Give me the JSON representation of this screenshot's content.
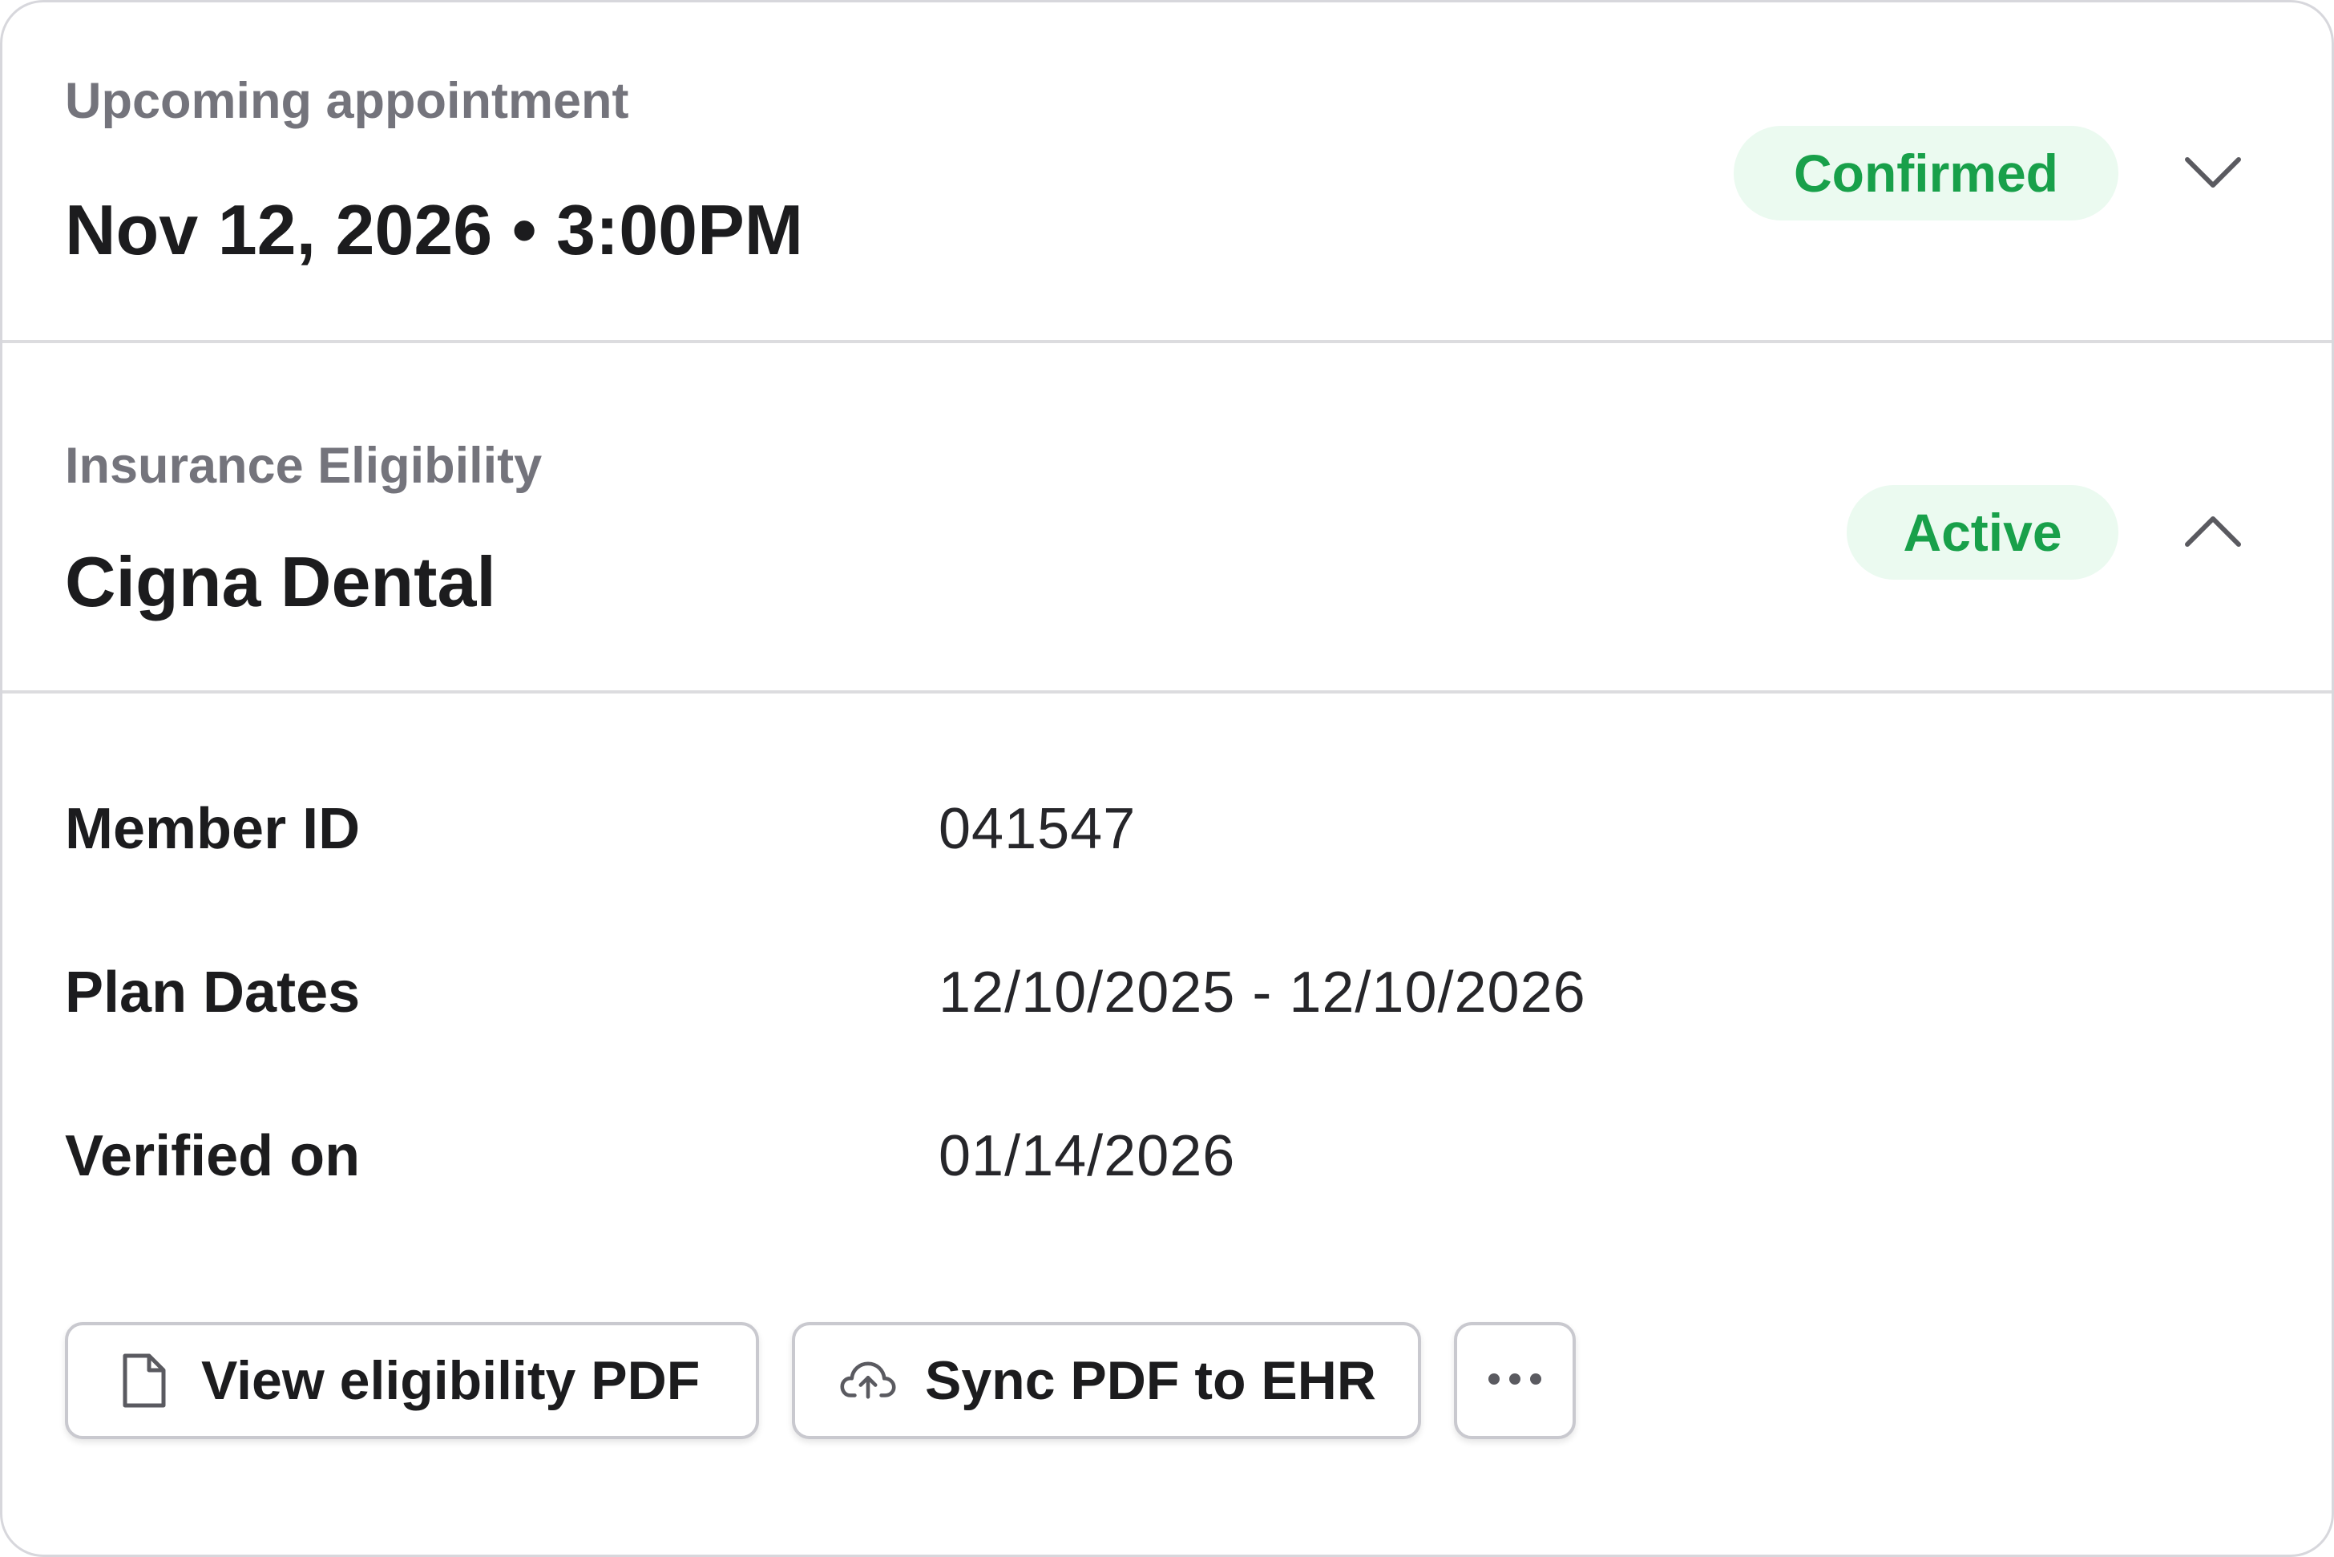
{
  "appointment": {
    "overline": "Upcoming appointment",
    "datetime": "Nov 12, 2026 • 3:00PM",
    "status": "Confirmed",
    "toggle_icon": "chevron-down-icon"
  },
  "insurance": {
    "overline": "Insurance Eligibility",
    "carrier": "Cigna Dental",
    "status": "Active",
    "toggle_icon": "chevron-up-icon",
    "details": [
      {
        "label": "Member ID",
        "value": "041547"
      },
      {
        "label": "Plan Dates",
        "value": "12/10/2025 - 12/10/2026"
      },
      {
        "label": "Verified on",
        "value": "01/14/2026"
      }
    ]
  },
  "actions": {
    "view_pdf": {
      "label": "View eligibility PDF",
      "icon": "document-icon"
    },
    "sync_pdf": {
      "label": "Sync PDF to EHR",
      "icon": "cloud-upload-icon"
    },
    "more": {
      "icon": "more-horizontal-icon"
    }
  },
  "colors": {
    "status_text": "#18a04a",
    "status_bg": "#ebfaf0",
    "muted_text": "#74747c",
    "primary_text": "#1c1c1e",
    "border": "#c9c9cf"
  }
}
